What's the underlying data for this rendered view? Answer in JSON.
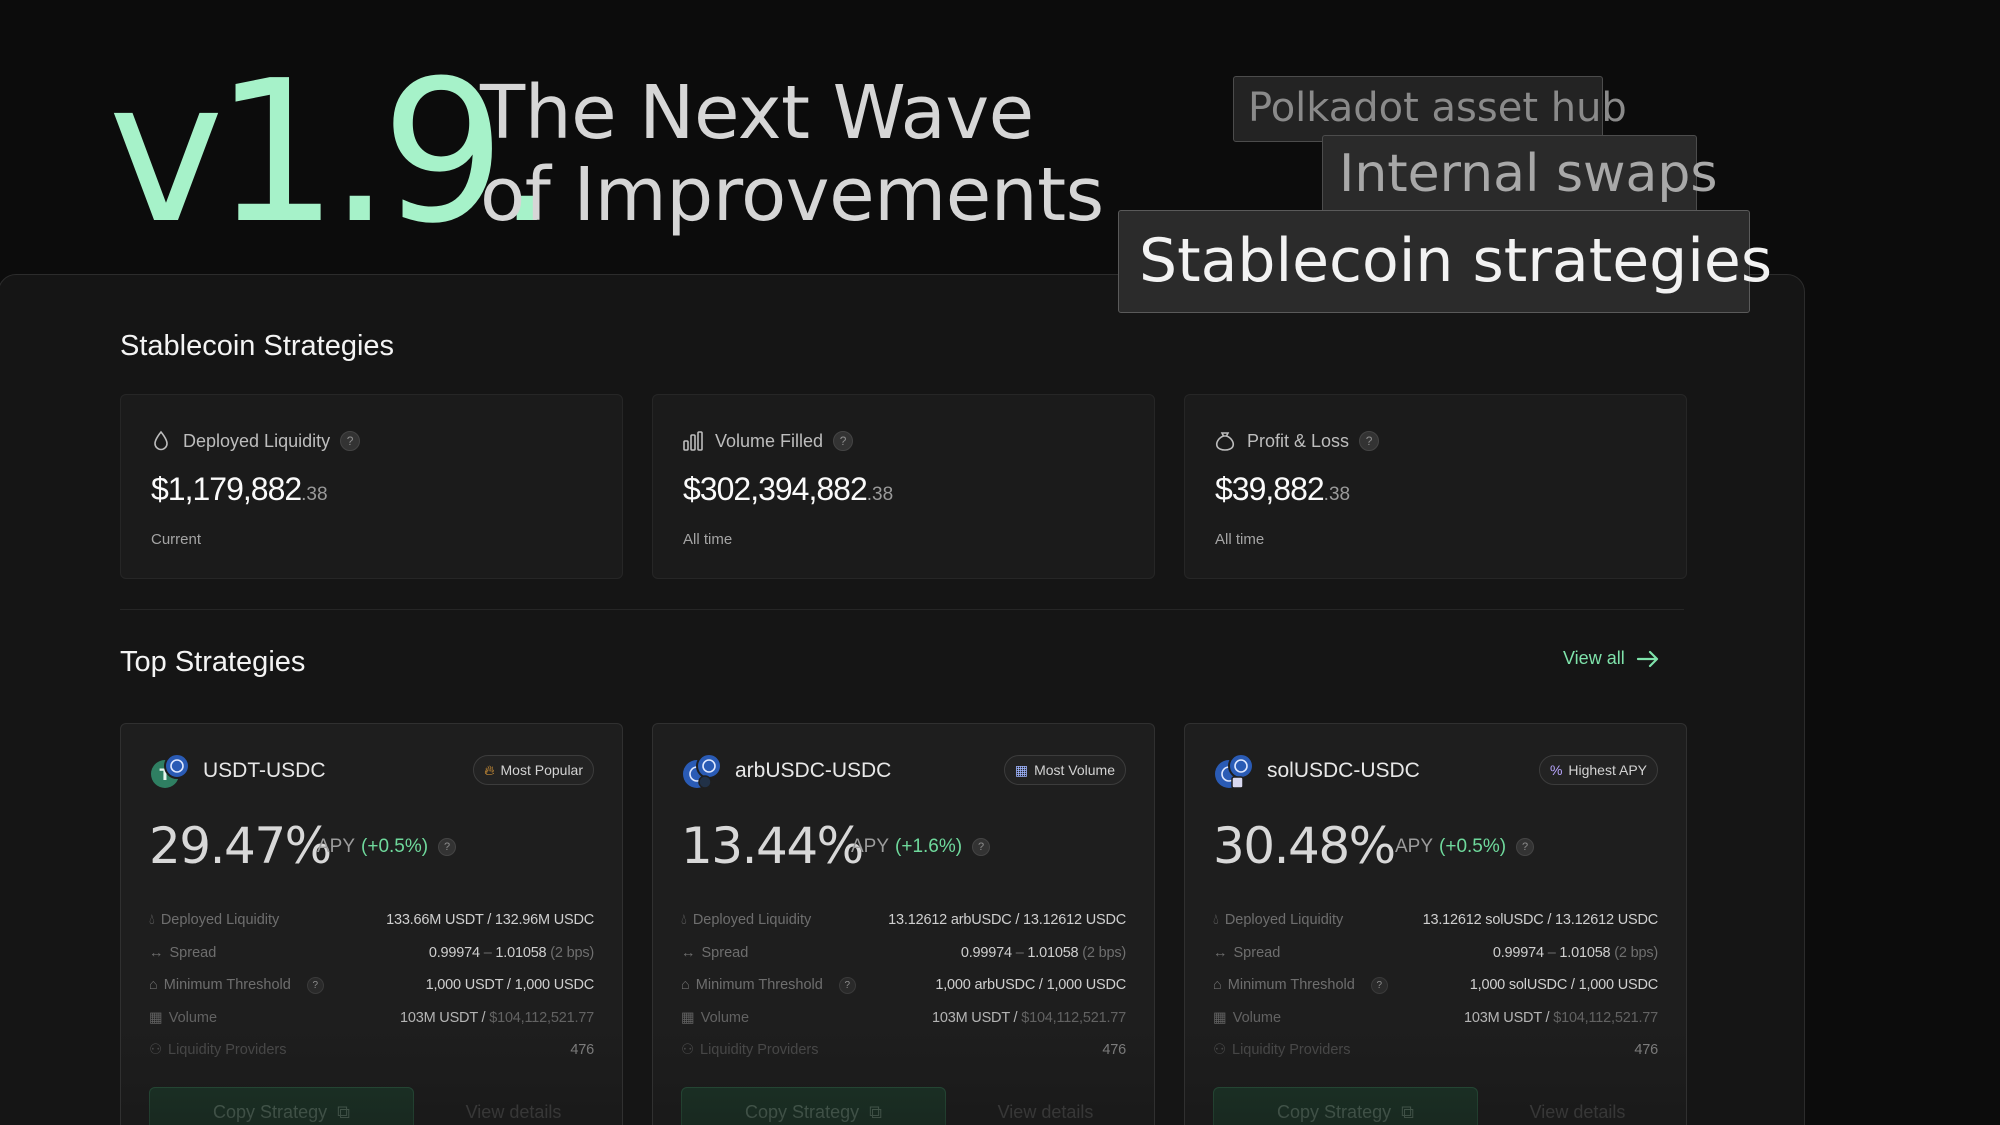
{
  "hero": {
    "version": "v1.9.",
    "title_line1": "The Next Wave",
    "title_line2": "of Improvements",
    "tags": [
      "Polkadot asset hub",
      "Internal swaps",
      "Stablecoin strategies"
    ]
  },
  "colors": {
    "accent": "#a6f2c9",
    "positive": "#6fd99c",
    "background": "#0c0c0c",
    "panel": "#151515"
  },
  "stablecoin_section": {
    "title": "Stablecoin Strategies",
    "stats": [
      {
        "icon": "droplet-icon",
        "label": "Deployed Liquidity",
        "help": "?",
        "value_main": "$1,179,882",
        "value_cents": ".38",
        "note": "Current"
      },
      {
        "icon": "bar-chart-icon",
        "label": "Volume Filled",
        "help": "?",
        "value_main": "$302,394,882",
        "value_cents": ".38",
        "note": "All time"
      },
      {
        "icon": "money-bag-icon",
        "label": "Profit & Loss",
        "help": "?",
        "value_main": "$39,882",
        "value_cents": ".38",
        "note": "All time"
      }
    ]
  },
  "top_section": {
    "title": "Top Strategies",
    "view_all": "View all",
    "copy_label": "Copy Strategy",
    "details_label": "View details",
    "row_labels": [
      "Deployed Liquidity",
      "Spread",
      "Minimum Threshold",
      "Volume",
      "Liquidity Providers"
    ],
    "cards": [
      {
        "name": "USDT-USDC",
        "badge": "Most Popular",
        "badge_icon": "flame-icon",
        "apy": "29.47%",
        "apy_label": "APY",
        "apy_change": "(+0.5%)",
        "liquidity": "133.66M USDT / 132.96M USDC",
        "spread_low": "0.99974",
        "spread_sep": "–",
        "spread_high": "1.01058",
        "spread_bps": "(2 bps)",
        "threshold": "1,000 USDT / 1,000 USDC",
        "volume_main": "103M USDT /",
        "volume_usd": "$104,112,521.77",
        "providers": "476"
      },
      {
        "name": "arbUSDC-USDC",
        "badge": "Most Volume",
        "badge_icon": "chart-box-icon",
        "apy": "13.44%",
        "apy_label": "APY",
        "apy_change": "(+1.6%)",
        "liquidity": "13.12612 arbUSDC / 13.12612 USDC",
        "spread_low": "0.99974",
        "spread_sep": "–",
        "spread_high": "1.01058",
        "spread_bps": "(2 bps)",
        "threshold": "1,000 arbUSDC / 1,000 USDC",
        "volume_main": "103M USDT /",
        "volume_usd": "$104,112,521.77",
        "providers": "476"
      },
      {
        "name": "solUSDC-USDC",
        "badge": "Highest APY",
        "badge_icon": "percent-icon",
        "apy": "30.48%",
        "apy_label": "APY",
        "apy_change": "(+0.5%)",
        "liquidity": "13.12612 solUSDC / 13.12612 USDC",
        "spread_low": "0.99974",
        "spread_sep": "–",
        "spread_high": "1.01058",
        "spread_bps": "(2 bps)",
        "threshold": "1,000 solUSDC / 1,000 USDC",
        "volume_main": "103M USDT /",
        "volume_usd": "$104,112,521.77",
        "providers": "476"
      }
    ]
  }
}
